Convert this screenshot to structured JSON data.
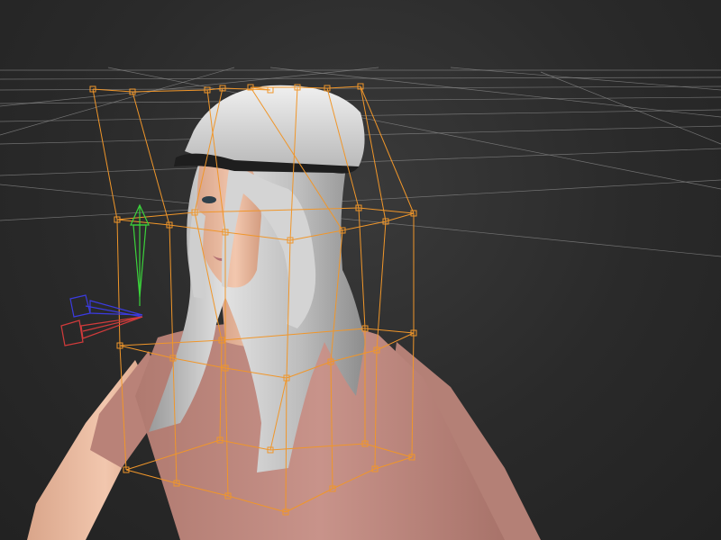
{
  "viewport": {
    "background": "#2b2b2b",
    "grid_color": "#8a8a8a",
    "lattice_color": "#f0962a",
    "skin_color": "#e8b89c",
    "shirt_color": "#c28b80",
    "hair_color": "#c9c9c9",
    "cap_color": "#dedede"
  },
  "gizmo": {
    "y_axis_color": "#3bd23b",
    "x_axis_color": "#d23b3b",
    "z_axis_color": "#3b3be0"
  }
}
